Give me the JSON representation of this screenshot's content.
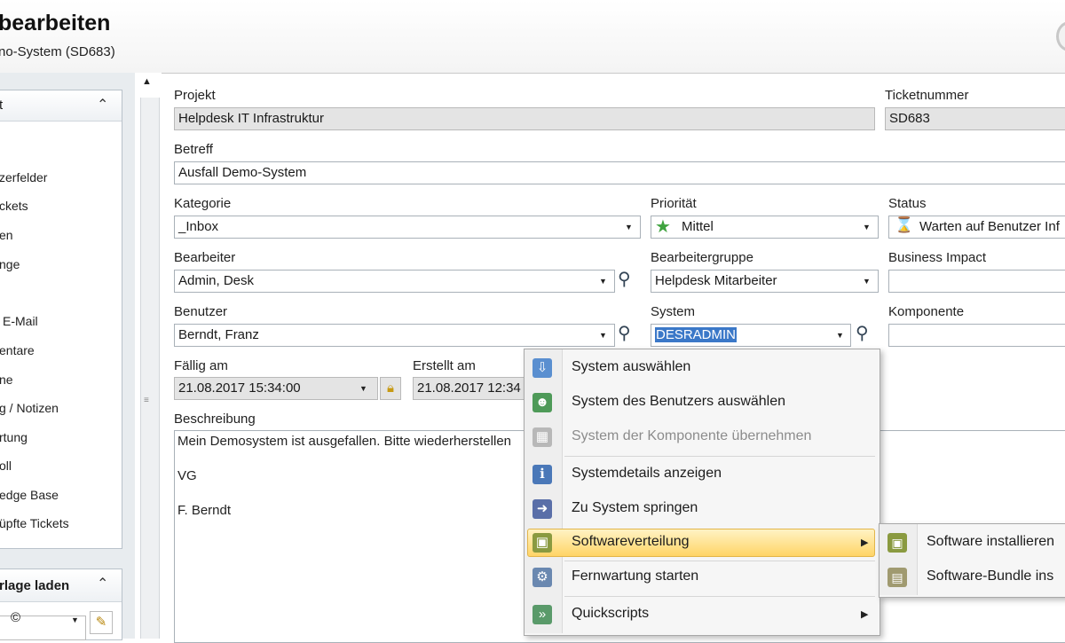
{
  "window": {
    "title": "bearbeiten",
    "subtitle": "no-System   (SD683)"
  },
  "sidebar": {
    "nav_header": "t",
    "nav_chevron": "⌃",
    "items": [
      "zerfelder",
      "ckets",
      "en",
      "nge",
      "E-Mail",
      "entare",
      "ne",
      "g / Notizen",
      "rtung",
      "oll",
      "edge Base",
      "üpfte Tickets"
    ],
    "template_header": "rlage laden",
    "template_chevron": "⌃",
    "template_copyright": "©"
  },
  "form": {
    "projekt": {
      "label": "Projekt",
      "value": "Helpdesk IT Infrastruktur"
    },
    "ticketnummer": {
      "label": "Ticketnummer",
      "value": "SD683"
    },
    "betreff": {
      "label": "Betreff",
      "value": "Ausfall Demo-System"
    },
    "kategorie": {
      "label": "Kategorie",
      "value": "_Inbox"
    },
    "prioritaet": {
      "label": "Priorität",
      "value": "Mittel"
    },
    "status": {
      "label": "Status",
      "value": "Warten auf Benutzer Inf"
    },
    "bearbeiter": {
      "label": "Bearbeiter",
      "value": "Admin, Desk"
    },
    "bearbeitergruppe": {
      "label": "Bearbeitergruppe",
      "value": "Helpdesk Mitarbeiter"
    },
    "business_impact": {
      "label": "Business Impact",
      "value": ""
    },
    "benutzer": {
      "label": "Benutzer",
      "value": "Berndt, Franz"
    },
    "system": {
      "label": "System",
      "value": "DESRADMIN"
    },
    "komponente": {
      "label": "Komponente",
      "value": ""
    },
    "faellig_am": {
      "label": "Fällig am",
      "value": "21.08.2017 15:34:00"
    },
    "erstellt_am": {
      "label": "Erstellt am",
      "value": "21.08.2017 12:34"
    },
    "beschreibung": {
      "label": "Beschreibung",
      "lines": [
        "Mein Demosystem ist ausgefallen. Bitte wiederherstellen",
        "VG",
        "F. Berndt"
      ]
    }
  },
  "context_menu": {
    "items": [
      {
        "label": "System auswählen",
        "disabled": false
      },
      {
        "label": "System des Benutzers auswählen",
        "disabled": false
      },
      {
        "label": "System der Komponente übernehmen",
        "disabled": true
      },
      {
        "label": "Systemdetails anzeigen",
        "disabled": false
      },
      {
        "label": "Zu System springen",
        "disabled": false
      },
      {
        "label": "Softwareverteilung",
        "disabled": false,
        "highlighted": true
      },
      {
        "label": "Fernwartung starten",
        "disabled": false
      },
      {
        "label": "Quickscripts",
        "disabled": false
      }
    ],
    "submenu": [
      {
        "label": "Software installieren"
      },
      {
        "label": "Software-Bundle ins"
      }
    ]
  },
  "colors": {
    "selection": "#3b78c8",
    "highlight": "#ffd466",
    "readonly_field": "#e4e4e4"
  }
}
